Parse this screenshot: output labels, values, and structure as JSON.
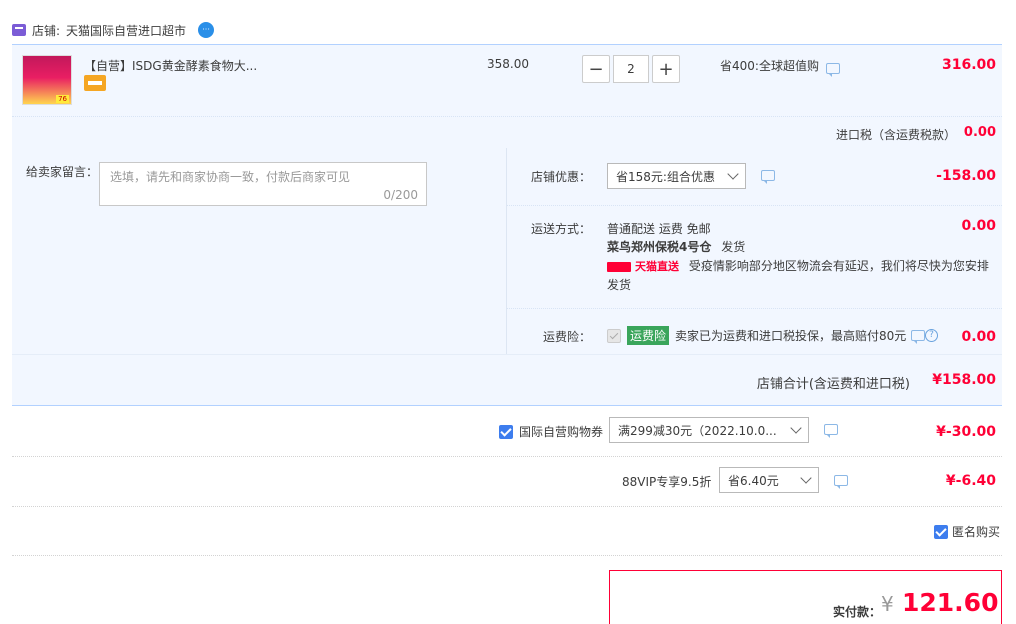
{
  "shop": {
    "label": "店铺:",
    "name": "天猫国际自营进口超市"
  },
  "item": {
    "title": "【自营】ISDG黄金酵素食物大...",
    "unit_price": "358.00",
    "quantity": "2",
    "minus": "−",
    "plus": "+",
    "promo": "省400:全球超值购",
    "subtotal": "316.00",
    "thumb_badge": "76",
    "tax_label": "进口税（含运费税款）",
    "tax_value": "0.00"
  },
  "memo": {
    "label": "给卖家留言：",
    "placeholder": "选填，请先和商家协商一致，付款后商家可见",
    "count": "0/200"
  },
  "shop_discount": {
    "label": "店铺优惠：",
    "selected": "省158元:组合优惠",
    "value": "-158.00"
  },
  "shipping": {
    "label": "运送方式：",
    "line1": "普通配送 运费 免邮",
    "warehouse": "菜鸟郑州保税4号仓",
    "ship_word": "发货",
    "tmall_tag": "天猫直送",
    "notice": "受疫情影响部分地区物流会有延迟，我们将尽快为您安排",
    "notice2": "发货",
    "value": "0.00"
  },
  "insurance": {
    "label": "运费险：",
    "tag": "运费险",
    "text": "卖家已为运费和进口税投保，最高赔付80元",
    "value": "0.00"
  },
  "shop_total": {
    "label": "店铺合计(含运费和进口税)",
    "value": "¥158.00"
  },
  "coupon": {
    "label": "国际自营购物券",
    "selected": "满299减30元（2022.10.0...",
    "value": "¥-30.00"
  },
  "vip": {
    "label": "88VIP专享9.5折",
    "selected": "省6.40元",
    "value": "¥-6.40"
  },
  "anonymous": {
    "label": "匿名购买"
  },
  "final": {
    "label": "实付款：",
    "currency": "¥",
    "amount": "121.60"
  },
  "colors": {
    "accent_red": "#ff0036",
    "blue": "#3d7dee",
    "panel_bg": "#f2f7ff"
  }
}
